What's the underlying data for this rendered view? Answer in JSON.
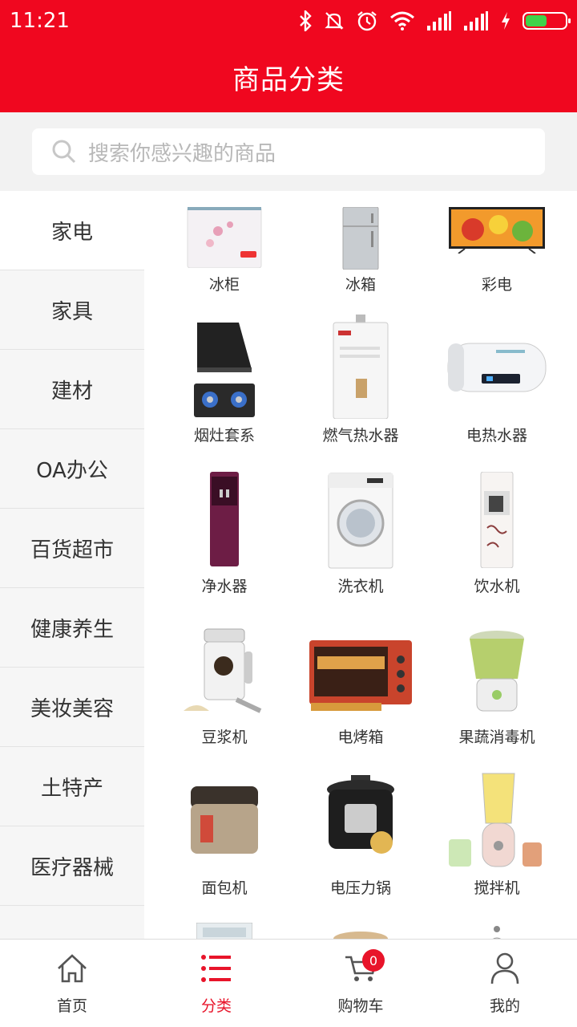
{
  "status_bar": {
    "time": "11:21",
    "icons": [
      "bluetooth-icon",
      "mute-icon",
      "alarm-icon",
      "wifi-icon",
      "signal-icon",
      "signal-icon",
      "charging-icon",
      "battery-icon"
    ]
  },
  "header": {
    "title": "商品分类"
  },
  "search": {
    "placeholder": "搜索你感兴趣的商品"
  },
  "sidebar": {
    "items": [
      {
        "label": "家电",
        "active": true
      },
      {
        "label": "家具",
        "active": false
      },
      {
        "label": "建材",
        "active": false
      },
      {
        "label": "OA办公",
        "active": false
      },
      {
        "label": "百货超市",
        "active": false
      },
      {
        "label": "健康养生",
        "active": false
      },
      {
        "label": "美妆美容",
        "active": false
      },
      {
        "label": "土特产",
        "active": false
      },
      {
        "label": "医疗器械",
        "active": false
      }
    ]
  },
  "products": [
    {
      "label": "冰柜",
      "icon": "chest-freezer"
    },
    {
      "label": "冰箱",
      "icon": "refrigerator"
    },
    {
      "label": "彩电",
      "icon": "television"
    },
    {
      "label": "烟灶套系",
      "icon": "range-hood-stove"
    },
    {
      "label": "燃气热水器",
      "icon": "gas-water-heater"
    },
    {
      "label": "电热水器",
      "icon": "electric-water-heater"
    },
    {
      "label": "净水器",
      "icon": "water-purifier"
    },
    {
      "label": "洗衣机",
      "icon": "washing-machine"
    },
    {
      "label": "饮水机",
      "icon": "water-dispenser"
    },
    {
      "label": "豆浆机",
      "icon": "soymilk-maker"
    },
    {
      "label": "电烤箱",
      "icon": "electric-oven"
    },
    {
      "label": "果蔬消毒机",
      "icon": "fruit-sterilizer"
    },
    {
      "label": "面包机",
      "icon": "bread-maker"
    },
    {
      "label": "电压力锅",
      "icon": "pressure-cooker"
    },
    {
      "label": "搅拌机",
      "icon": "blender"
    }
  ],
  "tabbar": {
    "items": [
      {
        "label": "首页",
        "icon": "home-icon",
        "active": false
      },
      {
        "label": "分类",
        "icon": "list-icon",
        "active": true
      },
      {
        "label": "购物车",
        "icon": "cart-icon",
        "active": false,
        "badge": "0"
      },
      {
        "label": "我的",
        "icon": "user-icon",
        "active": false
      }
    ]
  },
  "colors": {
    "brand_red": "#f0071f",
    "tab_active": "#e8142a",
    "sidebar_bg": "#f6f6f6"
  }
}
